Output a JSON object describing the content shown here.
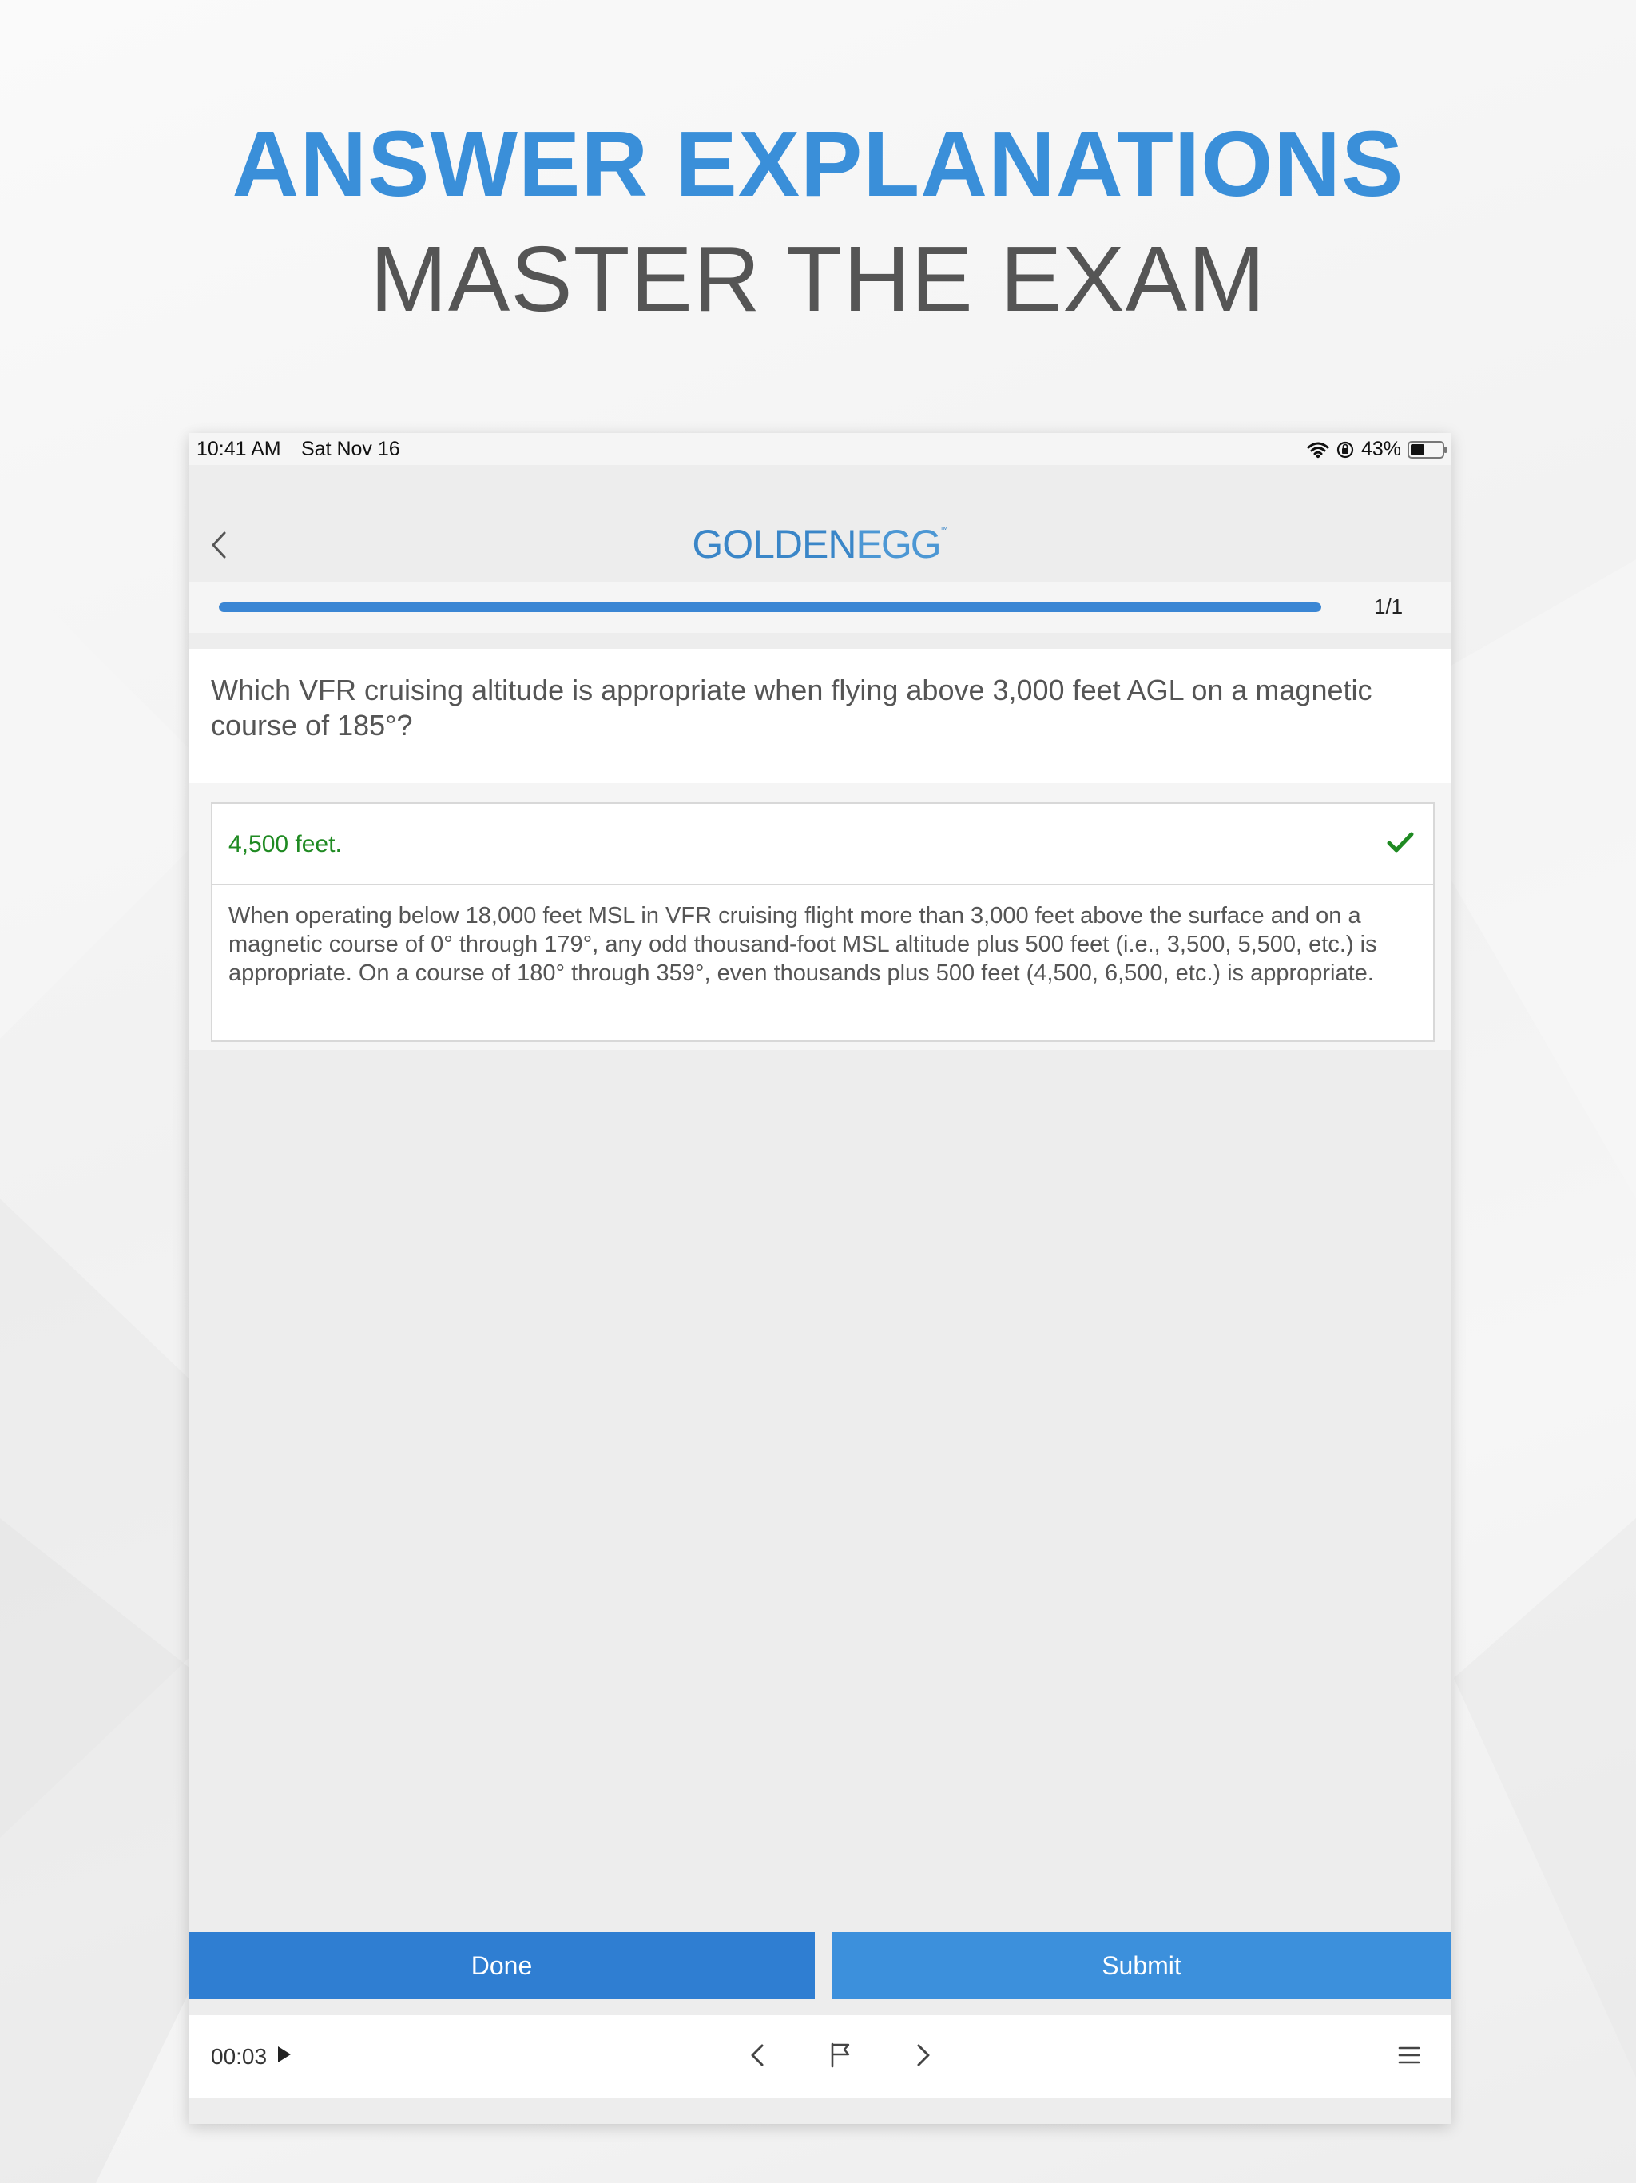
{
  "headline": {
    "line1": "ANSWER EXPLANATIONS",
    "line2": "MASTER THE EXAM"
  },
  "status_bar": {
    "time": "10:41 AM",
    "date": "Sat Nov 16",
    "battery": "43%"
  },
  "header": {
    "logo_part1": "GOLDEN",
    "logo_part2": "EGG",
    "logo_tm": "™"
  },
  "progress": {
    "count": "1/1",
    "fraction": 1.0
  },
  "question": {
    "text": "Which VFR cruising altitude is appropriate when flying above 3,000 feet AGL on a magnetic course of 185°?"
  },
  "answer": {
    "text": "4,500 feet.",
    "explanation": "When operating below 18,000 feet MSL in VFR cruising flight more than 3,000 feet above the surface and on a magnetic course of 0° through 179°, any odd thousand-foot MSL altitude plus 500 feet (i.e., 3,500, 5,500, etc.) is appropriate. On a course of 180° through 359°, even thousands plus 500 feet (4,500, 6,500, etc.) is appropriate."
  },
  "buttons": {
    "done": "Done",
    "submit": "Submit"
  },
  "bottom_bar": {
    "timer": "00:03"
  },
  "colors": {
    "accent": "#3a8fd9",
    "correct": "#1f8a22",
    "done_button": "#2f7ed2",
    "submit_button": "#3c90dc"
  }
}
